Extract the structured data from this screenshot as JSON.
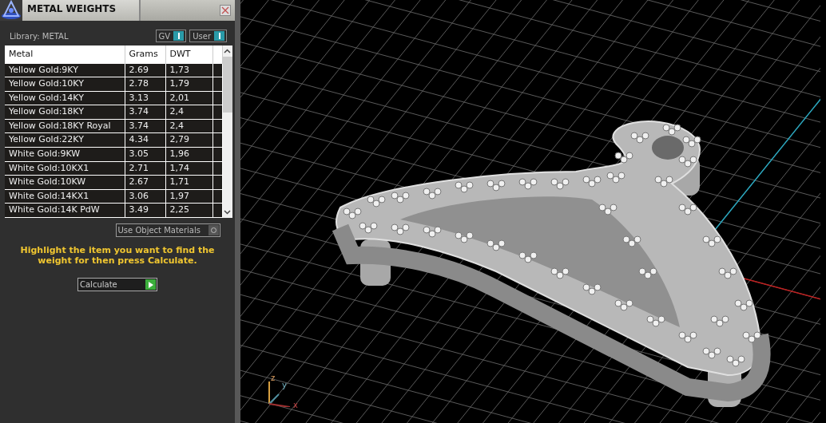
{
  "panel": {
    "title": "METAL WEIGHTS",
    "library_label": "Library: METAL",
    "toggles": [
      {
        "label": "GV",
        "on": true
      },
      {
        "label": "User",
        "on": true
      }
    ],
    "table": {
      "columns": [
        "Metal",
        "Grams",
        "DWT"
      ],
      "rows": [
        {
          "metal": "Yellow Gold:9KY",
          "grams": "2.69",
          "dwt": "1,73"
        },
        {
          "metal": "Yellow Gold:10KY",
          "grams": "2.78",
          "dwt": "1,79"
        },
        {
          "metal": "Yellow Gold:14KY",
          "grams": "3.13",
          "dwt": "2,01"
        },
        {
          "metal": "Yellow Gold:18KY",
          "grams": "3.74",
          "dwt": "2,4"
        },
        {
          "metal": "Yellow Gold:18KY Royal",
          "grams": "3.74",
          "dwt": "2,4"
        },
        {
          "metal": "Yellow Gold:22KY",
          "grams": "4.34",
          "dwt": "2,79"
        },
        {
          "metal": "White Gold:9KW",
          "grams": "3.05",
          "dwt": "1,96"
        },
        {
          "metal": "White Gold:10KX1",
          "grams": "2.71",
          "dwt": "1,74"
        },
        {
          "metal": "White Gold:10KW",
          "grams": "2.67",
          "dwt": "1,71"
        },
        {
          "metal": "White Gold:14KX1",
          "grams": "3.06",
          "dwt": "1,97"
        },
        {
          "metal": "White Gold:14K PdW",
          "grams": "3.49",
          "dwt": "2,25"
        }
      ]
    },
    "use_object_materials": {
      "label": "Use Object Materials",
      "on": false
    },
    "hint": "Highlight the item you want to find the weight for then press Calculate.",
    "calculate_button": "Calculate"
  },
  "viewport": {
    "axes": [
      {
        "label": "z"
      },
      {
        "label": "y"
      },
      {
        "label": "x"
      }
    ]
  }
}
